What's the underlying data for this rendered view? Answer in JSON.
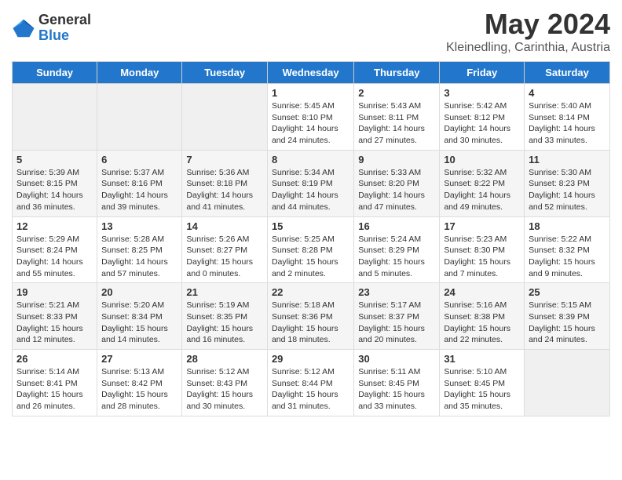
{
  "header": {
    "logo_general": "General",
    "logo_blue": "Blue",
    "title": "May 2024",
    "subtitle": "Kleinedling, Carinthia, Austria"
  },
  "weekdays": [
    "Sunday",
    "Monday",
    "Tuesday",
    "Wednesday",
    "Thursday",
    "Friday",
    "Saturday"
  ],
  "weeks": [
    [
      {
        "num": "",
        "info": ""
      },
      {
        "num": "",
        "info": ""
      },
      {
        "num": "",
        "info": ""
      },
      {
        "num": "1",
        "info": "Sunrise: 5:45 AM\nSunset: 8:10 PM\nDaylight: 14 hours and 24 minutes."
      },
      {
        "num": "2",
        "info": "Sunrise: 5:43 AM\nSunset: 8:11 PM\nDaylight: 14 hours and 27 minutes."
      },
      {
        "num": "3",
        "info": "Sunrise: 5:42 AM\nSunset: 8:12 PM\nDaylight: 14 hours and 30 minutes."
      },
      {
        "num": "4",
        "info": "Sunrise: 5:40 AM\nSunset: 8:14 PM\nDaylight: 14 hours and 33 minutes."
      }
    ],
    [
      {
        "num": "5",
        "info": "Sunrise: 5:39 AM\nSunset: 8:15 PM\nDaylight: 14 hours and 36 minutes."
      },
      {
        "num": "6",
        "info": "Sunrise: 5:37 AM\nSunset: 8:16 PM\nDaylight: 14 hours and 39 minutes."
      },
      {
        "num": "7",
        "info": "Sunrise: 5:36 AM\nSunset: 8:18 PM\nDaylight: 14 hours and 41 minutes."
      },
      {
        "num": "8",
        "info": "Sunrise: 5:34 AM\nSunset: 8:19 PM\nDaylight: 14 hours and 44 minutes."
      },
      {
        "num": "9",
        "info": "Sunrise: 5:33 AM\nSunset: 8:20 PM\nDaylight: 14 hours and 47 minutes."
      },
      {
        "num": "10",
        "info": "Sunrise: 5:32 AM\nSunset: 8:22 PM\nDaylight: 14 hours and 49 minutes."
      },
      {
        "num": "11",
        "info": "Sunrise: 5:30 AM\nSunset: 8:23 PM\nDaylight: 14 hours and 52 minutes."
      }
    ],
    [
      {
        "num": "12",
        "info": "Sunrise: 5:29 AM\nSunset: 8:24 PM\nDaylight: 14 hours and 55 minutes."
      },
      {
        "num": "13",
        "info": "Sunrise: 5:28 AM\nSunset: 8:25 PM\nDaylight: 14 hours and 57 minutes."
      },
      {
        "num": "14",
        "info": "Sunrise: 5:26 AM\nSunset: 8:27 PM\nDaylight: 15 hours and 0 minutes."
      },
      {
        "num": "15",
        "info": "Sunrise: 5:25 AM\nSunset: 8:28 PM\nDaylight: 15 hours and 2 minutes."
      },
      {
        "num": "16",
        "info": "Sunrise: 5:24 AM\nSunset: 8:29 PM\nDaylight: 15 hours and 5 minutes."
      },
      {
        "num": "17",
        "info": "Sunrise: 5:23 AM\nSunset: 8:30 PM\nDaylight: 15 hours and 7 minutes."
      },
      {
        "num": "18",
        "info": "Sunrise: 5:22 AM\nSunset: 8:32 PM\nDaylight: 15 hours and 9 minutes."
      }
    ],
    [
      {
        "num": "19",
        "info": "Sunrise: 5:21 AM\nSunset: 8:33 PM\nDaylight: 15 hours and 12 minutes."
      },
      {
        "num": "20",
        "info": "Sunrise: 5:20 AM\nSunset: 8:34 PM\nDaylight: 15 hours and 14 minutes."
      },
      {
        "num": "21",
        "info": "Sunrise: 5:19 AM\nSunset: 8:35 PM\nDaylight: 15 hours and 16 minutes."
      },
      {
        "num": "22",
        "info": "Sunrise: 5:18 AM\nSunset: 8:36 PM\nDaylight: 15 hours and 18 minutes."
      },
      {
        "num": "23",
        "info": "Sunrise: 5:17 AM\nSunset: 8:37 PM\nDaylight: 15 hours and 20 minutes."
      },
      {
        "num": "24",
        "info": "Sunrise: 5:16 AM\nSunset: 8:38 PM\nDaylight: 15 hours and 22 minutes."
      },
      {
        "num": "25",
        "info": "Sunrise: 5:15 AM\nSunset: 8:39 PM\nDaylight: 15 hours and 24 minutes."
      }
    ],
    [
      {
        "num": "26",
        "info": "Sunrise: 5:14 AM\nSunset: 8:41 PM\nDaylight: 15 hours and 26 minutes."
      },
      {
        "num": "27",
        "info": "Sunrise: 5:13 AM\nSunset: 8:42 PM\nDaylight: 15 hours and 28 minutes."
      },
      {
        "num": "28",
        "info": "Sunrise: 5:12 AM\nSunset: 8:43 PM\nDaylight: 15 hours and 30 minutes."
      },
      {
        "num": "29",
        "info": "Sunrise: 5:12 AM\nSunset: 8:44 PM\nDaylight: 15 hours and 31 minutes."
      },
      {
        "num": "30",
        "info": "Sunrise: 5:11 AM\nSunset: 8:45 PM\nDaylight: 15 hours and 33 minutes."
      },
      {
        "num": "31",
        "info": "Sunrise: 5:10 AM\nSunset: 8:45 PM\nDaylight: 15 hours and 35 minutes."
      },
      {
        "num": "",
        "info": ""
      }
    ]
  ]
}
